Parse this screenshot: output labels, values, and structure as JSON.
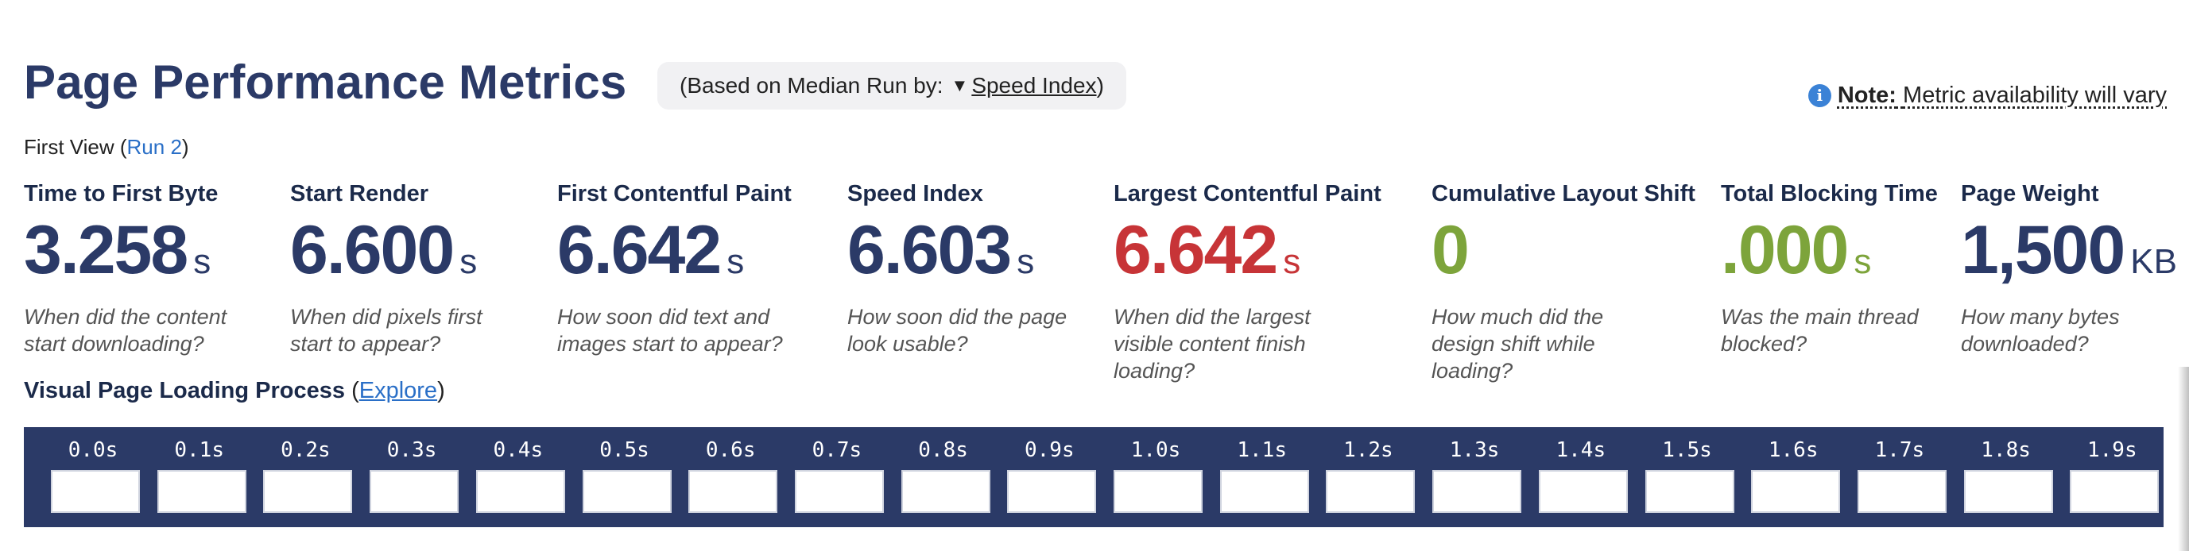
{
  "header": {
    "title": "Page Performance Metrics",
    "median_prefix": "(Based on Median Run by:",
    "median_link": "Speed Index",
    "median_suffix": ")"
  },
  "note": {
    "bold": "Note:",
    "text": "Metric availability will vary"
  },
  "first_view": {
    "label": "First View (",
    "run_link": "Run 2",
    "close": ")"
  },
  "metrics": [
    {
      "label": "Time to First Byte",
      "value": "3.258",
      "unit": "s",
      "desc": "When did the content start downloading?",
      "color": "#2b3a67"
    },
    {
      "label": "Start Render",
      "value": "6.600",
      "unit": "s",
      "desc": "When did pixels first start to appear?",
      "color": "#2b3a67"
    },
    {
      "label": "First Contentful Paint",
      "value": "6.642",
      "unit": "s",
      "desc": "How soon did text and images start to appear?",
      "color": "#2b3a67"
    },
    {
      "label": "Speed Index",
      "value": "6.603",
      "unit": "s",
      "desc": "How soon did the page look usable?",
      "color": "#2b3a67"
    },
    {
      "label": "Largest Contentful Paint",
      "value": "6.642",
      "unit": "s",
      "desc": "When did the largest visible content finish loading?",
      "color": "#c73437"
    },
    {
      "label": "Cumulative Layout Shift",
      "value": "0",
      "unit": "",
      "desc": "How much did the design shift while loading?",
      "color": "#7da43b"
    },
    {
      "label": "Total Blocking Time",
      "value": ".000",
      "unit": "s",
      "desc": "Was the main thread blocked?",
      "color": "#7da43b"
    },
    {
      "label": "Page Weight",
      "value": "1,500",
      "unit": "KB",
      "desc": "How many bytes downloaded?",
      "color": "#2b3a67"
    }
  ],
  "visual": {
    "title": "Visual Page Loading Process",
    "explore_open": " (",
    "explore_link": "Explore",
    "explore_close": ")"
  },
  "filmstrip": [
    "0.0s",
    "0.1s",
    "0.2s",
    "0.3s",
    "0.4s",
    "0.5s",
    "0.6s",
    "0.7s",
    "0.8s",
    "0.9s",
    "1.0s",
    "1.1s",
    "1.2s",
    "1.3s",
    "1.4s",
    "1.5s",
    "1.6s",
    "1.7s",
    "1.8s",
    "1.9s"
  ]
}
